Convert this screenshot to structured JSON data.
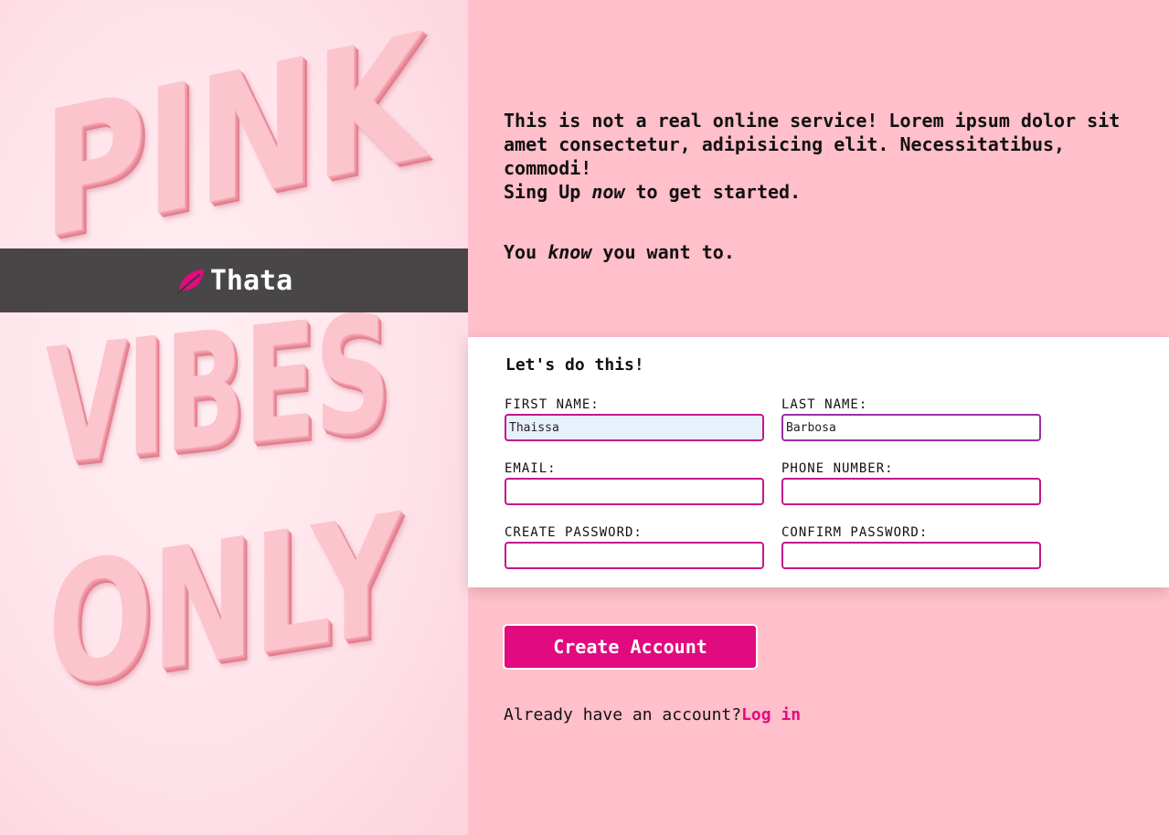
{
  "hero": {
    "words": [
      "PINK",
      "VIBES",
      "ONLY"
    ]
  },
  "brand": {
    "name": "Thata",
    "logo_icon": "leaf-icon",
    "logo_color": "#e20a7f"
  },
  "intro": {
    "line1": "This is not a real online service! Lorem ipsum dolor sit amet consectetur, adipisicing elit. Necessitatibus, commodi!",
    "line2_before": "Sing Up ",
    "line2_em": "now",
    "line2_after": " to get started.",
    "line3_before": "You ",
    "line3_em": "know",
    "line3_after": " you want to."
  },
  "form": {
    "title": "Let's do this!",
    "first_name": {
      "label": "FIRST NAME:",
      "value": "Thaissa"
    },
    "last_name": {
      "label": "LAST NAME:",
      "value": "Barbosa"
    },
    "email": {
      "label": "EMAIL:",
      "value": ""
    },
    "phone": {
      "label": "PHONE NUMBER:",
      "value": ""
    },
    "password": {
      "label": "CREATE PASSWORD:",
      "value": ""
    },
    "confirm_password": {
      "label": "CONFIRM PASSWORD:",
      "value": ""
    }
  },
  "actions": {
    "create_label": "Create Account",
    "login_prompt": "Already have an account?",
    "login_link": "Log in"
  },
  "colors": {
    "accent": "#e20a7f",
    "page_background": "#ffbfcb",
    "brand_bar": "#3a3738"
  }
}
